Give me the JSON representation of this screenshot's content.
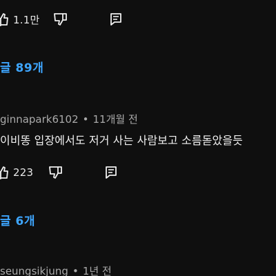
{
  "comments": [
    {
      "text": "",
      "likes": "1.1만",
      "replies_label": "글 89개"
    },
    {
      "author": "ginnapark6102",
      "time": "11개월 전",
      "text": "이비똥 입장에서도 저거 사는 사람보고 소름돋았을듯",
      "likes": "223",
      "replies_label": "글 6개"
    },
    {
      "author": "seungsikjung",
      "time": "1년 전"
    }
  ],
  "meta_separator": "•",
  "icons": {
    "like": "thumb-up-icon",
    "dislike": "thumb-down-icon",
    "reply": "reply-comment-icon"
  },
  "colors": {
    "background": "#0f0f0f",
    "link": "#3ea6ff",
    "meta": "#aaaaaa",
    "text": "#f1f1f1"
  }
}
